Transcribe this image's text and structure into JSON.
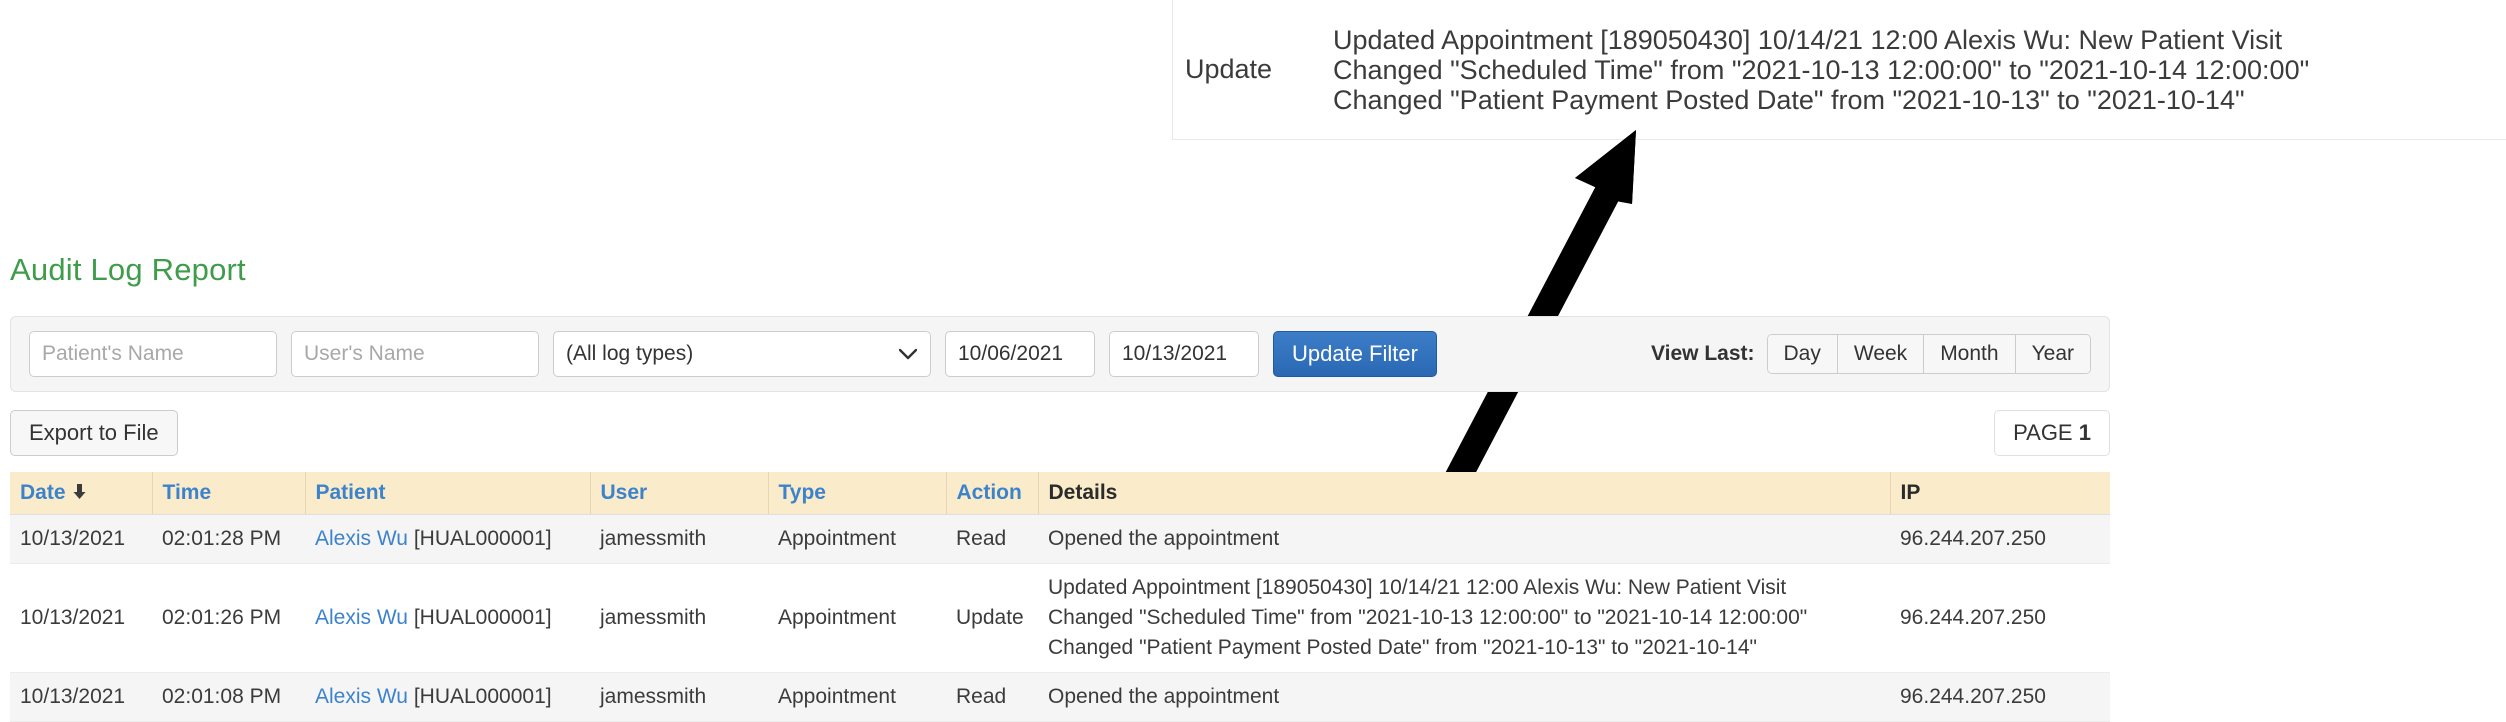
{
  "callout": {
    "action": "Update",
    "details": [
      "Updated Appointment [189050430] 10/14/21 12:00 Alexis Wu: New Patient Visit",
      "Changed \"Scheduled Time\" from \"2021-10-13 12:00:00\" to \"2021-10-14 12:00:00\"",
      "Changed \"Patient Payment Posted Date\" from \"2021-10-13\" to \"2021-10-14\""
    ]
  },
  "page": {
    "title": "Audit Log Report",
    "title_color": "#3f9c4a"
  },
  "filter": {
    "patient_name_placeholder": "Patient's Name",
    "patient_name_value": "",
    "user_name_placeholder": "User's Name",
    "user_name_value": "",
    "log_type_selected": "(All log types)",
    "log_type_options": [
      "(All log types)"
    ],
    "date_from_value": "10/06/2021",
    "date_to_value": "10/13/2021",
    "update_filter_label": "Update Filter",
    "update_filter_color": "#2b6cb8",
    "view_last_label": "View Last:",
    "view_last_options": [
      "Day",
      "Week",
      "Month",
      "Year"
    ]
  },
  "actions": {
    "export_label": "Export to File",
    "page_label": "PAGE",
    "page_number": "1"
  },
  "table": {
    "columns": [
      {
        "label": "Date",
        "sortable": true,
        "sort_icon": "sort-desc-icon"
      },
      {
        "label": "Time",
        "sortable": true
      },
      {
        "label": "Patient",
        "sortable": true
      },
      {
        "label": "User",
        "sortable": true
      },
      {
        "label": "Type",
        "sortable": true
      },
      {
        "label": "Action",
        "sortable": true
      },
      {
        "label": "Details",
        "sortable": false
      },
      {
        "label": "IP",
        "sortable": false
      }
    ],
    "rows": [
      {
        "date": "10/13/2021",
        "time": "02:01:28 PM",
        "patient_name": "Alexis Wu",
        "patient_id": "[HUAL000001]",
        "user": "jamessmith",
        "type": "Appointment",
        "action": "Read",
        "details": [
          "Opened the appointment"
        ],
        "ip": "96.244.207.250"
      },
      {
        "date": "10/13/2021",
        "time": "02:01:26 PM",
        "patient_name": "Alexis Wu",
        "patient_id": "[HUAL000001]",
        "user": "jamessmith",
        "type": "Appointment",
        "action": "Update",
        "details": [
          "Updated Appointment [189050430] 10/14/21 12:00 Alexis Wu: New Patient Visit",
          "Changed \"Scheduled Time\" from \"2021-10-13 12:00:00\" to \"2021-10-14 12:00:00\"",
          "Changed \"Patient Payment Posted Date\" from \"2021-10-13\" to \"2021-10-14\""
        ],
        "ip": "96.244.207.250"
      },
      {
        "date": "10/13/2021",
        "time": "02:01:08 PM",
        "patient_name": "Alexis Wu",
        "patient_id": "[HUAL000001]",
        "user": "jamessmith",
        "type": "Appointment",
        "action": "Read",
        "details": [
          "Opened the appointment"
        ],
        "ip": "96.244.207.250"
      }
    ]
  }
}
